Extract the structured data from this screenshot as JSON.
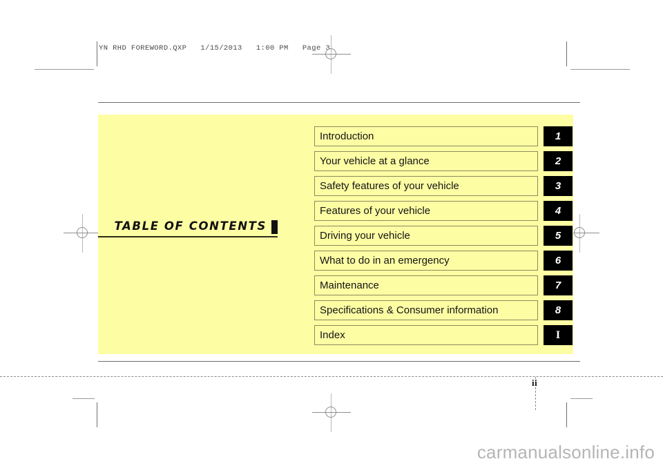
{
  "prepress": {
    "header_line": "YN RHD FOREWORD.QXP   1/15/2013   1:00 PM   Page 3"
  },
  "heading": {
    "title": "TABLE  OF  CONTENTS"
  },
  "toc": {
    "rows": [
      {
        "label": "Introduction",
        "tab": "1"
      },
      {
        "label": "Your vehicle at a glance",
        "tab": "2"
      },
      {
        "label": "Safety features of your vehicle",
        "tab": "3"
      },
      {
        "label": "Features of your vehicle",
        "tab": "4"
      },
      {
        "label": "Driving your vehicle",
        "tab": "5"
      },
      {
        "label": "What to do in an emergency",
        "tab": "6"
      },
      {
        "label": "Maintenance",
        "tab": "7"
      },
      {
        "label": "Specifications & Consumer information",
        "tab": "8"
      },
      {
        "label": "Index",
        "tab": "I"
      }
    ]
  },
  "folio": {
    "page_number": "ii"
  },
  "watermark": {
    "text": "carmanualsonline.info"
  },
  "colors": {
    "panel_yellow": "#fdfda4",
    "tab_black": "#000000",
    "row_border": "#8b8b5e",
    "rule_gray": "#6b6b6b",
    "watermark_gray": "#b5b5b5"
  }
}
